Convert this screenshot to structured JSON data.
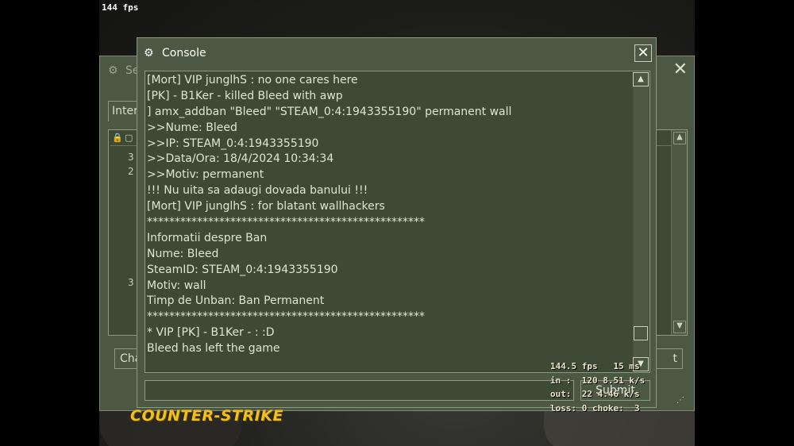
{
  "hud": {
    "fps_top": "144 fps"
  },
  "server_browser": {
    "title_fragment": "Se",
    "tab_fragment": "Inter",
    "row_numbers": [
      "3",
      "2",
      "3"
    ],
    "change_button_fragment": "Cha",
    "right_button_fragment": "t"
  },
  "console": {
    "title": "Console",
    "close_label": "✕",
    "lines": [
      "[Mort] VIP junglhS : no one cares here",
      "[PK] - B1Ker - killed Bleed with awp",
      "] amx_addban \"Bleed\" \"STEAM_0:4:1943355190\" permanent wall",
      ">>Nume: Bleed",
      ">>IP: STEAM_0:4:1943355190",
      ">>Data/Ora: 18/4/2024 10:34:34",
      ">>Motiv: permanent",
      "!!! Nu uita sa adaugi dovada banului !!!",
      "[Mort] VIP junglhS : for blatant wallhackers",
      "**************************************************",
      "Informatii despre Ban",
      "Nume: Bleed",
      "SteamID: STEAM_0:4:1943355190",
      "Motiv: wall",
      "Timp de Unban: Ban Permanent",
      "**************************************************",
      "* VIP [PK] - B1Ker - : :D",
      "Bleed has left the game"
    ],
    "input_value": "",
    "submit_label": "Submit"
  },
  "netgraph": {
    "line1": "144.5 fps   15 ms",
    "line2": "in :  120 8.51 k/s",
    "line3": "out:  22 4.46 k/s",
    "line4": "loss: 0 choke:  3"
  },
  "logo": {
    "text": "COUNTER-STRIKE"
  },
  "colors": {
    "window_bg": "#4c5844",
    "panel_bg": "#3e4936",
    "text": "#dfe5d6",
    "logo": "#f0c020"
  }
}
